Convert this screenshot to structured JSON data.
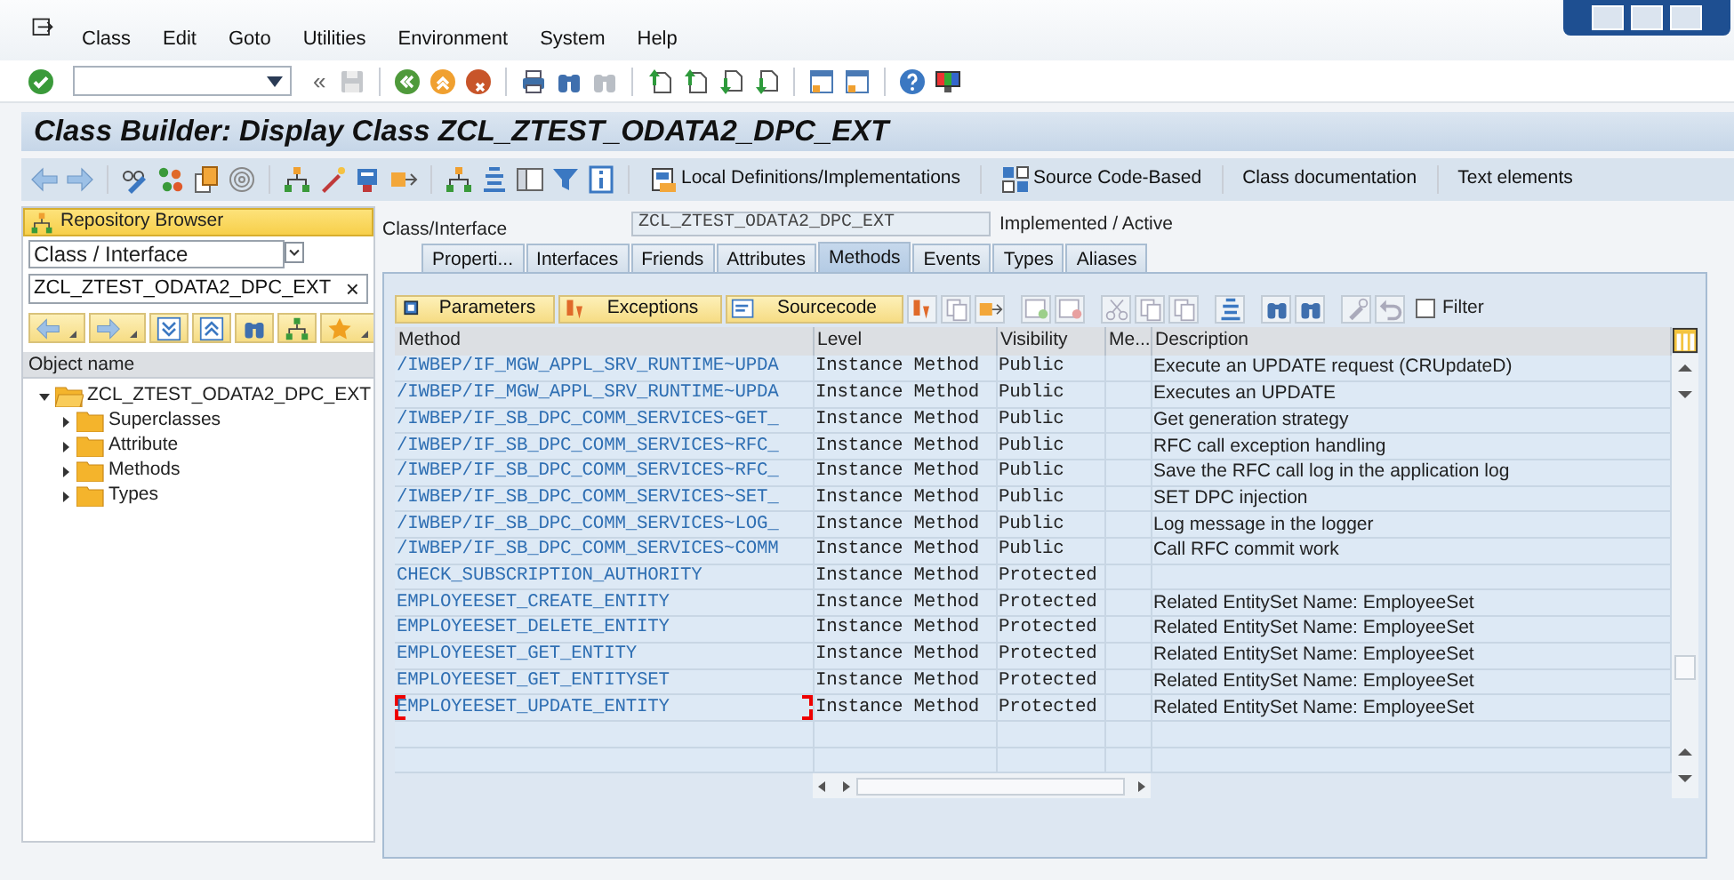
{
  "menu_bar": {
    "items": [
      "Class",
      "Edit",
      "Goto",
      "Utilities",
      "Environment",
      "System",
      "Help"
    ]
  },
  "toolbar": {
    "back_marker": "«"
  },
  "title": "Class Builder: Display Class ZCL_ZTEST_ODATA2_DPC_EXT",
  "app_toolbar": {
    "buttons": [
      {
        "label": "Local Definitions/Implementations"
      },
      {
        "label": "Source Code-Based"
      },
      {
        "label": "Class documentation"
      },
      {
        "label": "Text elements"
      }
    ]
  },
  "repository_browser": {
    "title": "Repository Browser",
    "object_type": "Class / Interface",
    "object_name": "ZCL_ZTEST_ODATA2_DPC_EXT",
    "clear": "×",
    "column": "Object name",
    "tree": [
      {
        "label": "ZCL_ZTEST_ODATA2_DPC_EXT",
        "expanded": true,
        "children": [
          {
            "label": "Superclasses",
            "expanded": false
          },
          {
            "label": "Attribute",
            "expanded": false
          },
          {
            "label": "Methods",
            "expanded": false
          },
          {
            "label": "Types",
            "expanded": false
          }
        ]
      }
    ]
  },
  "class_header": {
    "label": "Class/Interface",
    "value": "ZCL_ZTEST_ODATA2_DPC_EXT",
    "status": "Implemented / Active"
  },
  "tabs": [
    {
      "label": "Properti...",
      "selected": false
    },
    {
      "label": "Interfaces",
      "selected": false
    },
    {
      "label": "Friends",
      "selected": false
    },
    {
      "label": "Attributes",
      "selected": false
    },
    {
      "label": "Methods",
      "selected": true
    },
    {
      "label": "Events",
      "selected": false
    },
    {
      "label": "Types",
      "selected": false
    },
    {
      "label": "Aliases",
      "selected": false
    }
  ],
  "method_toolbar": {
    "buttons": [
      "Parameters",
      "Exceptions",
      "Sourcecode"
    ],
    "filter": {
      "label": "Filter",
      "checked": false
    }
  },
  "table": {
    "columns": [
      "Method",
      "Level",
      "Visibility",
      "Me...",
      "Description"
    ],
    "rows": [
      {
        "method": "/IWBEP/IF_MGW_APPL_SRV_RUNTIME~UPDA",
        "level": "Instance Method",
        "visibility": "Public",
        "description": "Execute an UPDATE request (CRUpdateD)",
        "focused": false
      },
      {
        "method": "/IWBEP/IF_MGW_APPL_SRV_RUNTIME~UPDA",
        "level": "Instance Method",
        "visibility": "Public",
        "description": "Executes an UPDATE",
        "focused": false
      },
      {
        "method": "/IWBEP/IF_SB_DPC_COMM_SERVICES~GET_",
        "level": "Instance Method",
        "visibility": "Public",
        "description": "Get generation strategy",
        "focused": false
      },
      {
        "method": "/IWBEP/IF_SB_DPC_COMM_SERVICES~RFC_",
        "level": "Instance Method",
        "visibility": "Public",
        "description": "RFC call exception handling",
        "focused": false
      },
      {
        "method": "/IWBEP/IF_SB_DPC_COMM_SERVICES~RFC_",
        "level": "Instance Method",
        "visibility": "Public",
        "description": "Save the RFC call log in the application log",
        "focused": false
      },
      {
        "method": "/IWBEP/IF_SB_DPC_COMM_SERVICES~SET_",
        "level": "Instance Method",
        "visibility": "Public",
        "description": "SET DPC injection",
        "focused": false
      },
      {
        "method": "/IWBEP/IF_SB_DPC_COMM_SERVICES~LOG_",
        "level": "Instance Method",
        "visibility": "Public",
        "description": "Log message in the logger",
        "focused": false
      },
      {
        "method": "/IWBEP/IF_SB_DPC_COMM_SERVICES~COMM",
        "level": "Instance Method",
        "visibility": "Public",
        "description": "Call RFC commit work",
        "focused": false
      },
      {
        "method": "CHECK_SUBSCRIPTION_AUTHORITY",
        "level": "Instance Method",
        "visibility": "Protected",
        "focused": false
      },
      {
        "method": "EMPLOYEESET_CREATE_ENTITY",
        "level": "Instance Method",
        "visibility": "Protected",
        "description": "Related EntitySet Name: EmployeeSet",
        "focused": false
      },
      {
        "method": "EMPLOYEESET_DELETE_ENTITY",
        "level": "Instance Method",
        "visibility": "Protected",
        "description": "Related EntitySet Name: EmployeeSet",
        "focused": false
      },
      {
        "method": "EMPLOYEESET_GET_ENTITY",
        "level": "Instance Method",
        "visibility": "Protected",
        "description": "Related EntitySet Name: EmployeeSet",
        "focused": false
      },
      {
        "method": "EMPLOYEESET_GET_ENTITYSET",
        "level": "Instance Method",
        "visibility": "Protected",
        "description": "Related EntitySet Name: EmployeeSet",
        "focused": false
      },
      {
        "method": "EMPLOYEESET_UPDATE_ENTITY",
        "level": "Instance Method",
        "visibility": "Protected",
        "description": "Related EntitySet Name: EmployeeSet",
        "focused": true
      }
    ]
  }
}
